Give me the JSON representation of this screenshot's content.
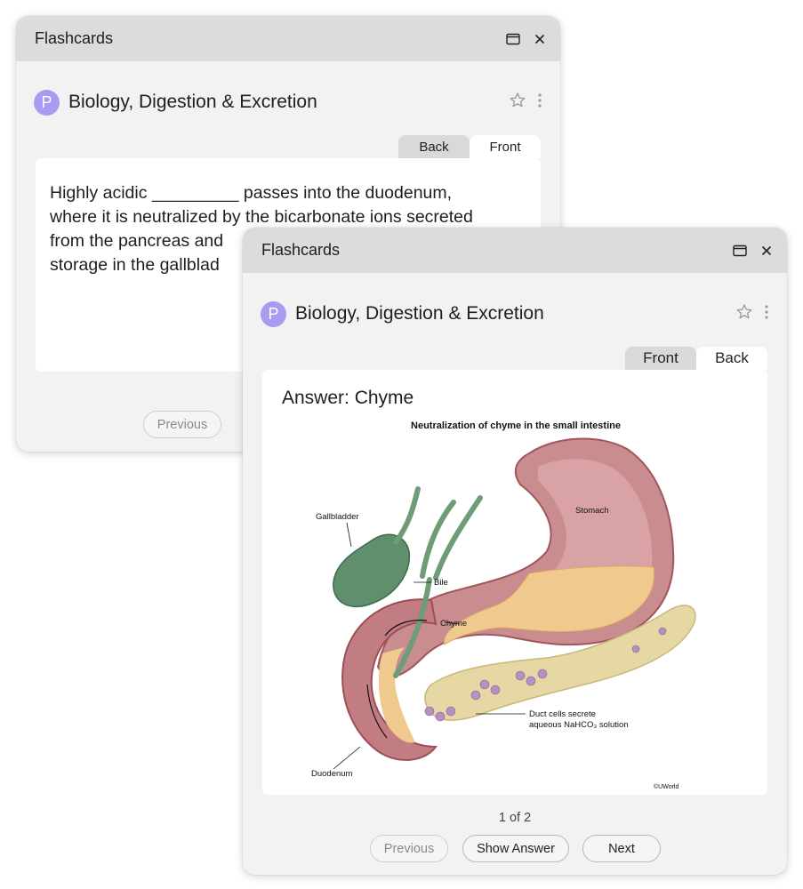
{
  "back_window": {
    "title": "Flashcards",
    "deck": {
      "avatar_letter": "P",
      "name": "Biology, Digestion & Excretion"
    },
    "tabs": [
      {
        "label": "Back",
        "active": false
      },
      {
        "label": "Front",
        "active": true
      }
    ],
    "card_text": "Highly acidic _________ passes into the duodenum, where it is neutralized by the bicarbonate ions secreted from the pancreas and ... storage in the gallblad...",
    "card_lines": [
      "Highly acidic _________ passes into the duodenum,",
      "where it is neutralized by the bicarbonate ions secreted",
      "from the pancreas and",
      "storage in the gallblad"
    ],
    "buttons": {
      "previous": "Previous"
    }
  },
  "front_window": {
    "title": "Flashcards",
    "deck": {
      "avatar_letter": "P",
      "name": "Biology, Digestion & Excretion"
    },
    "tabs": [
      {
        "label": "Front",
        "active": false
      },
      {
        "label": "Back",
        "active": true
      }
    ],
    "answer": "Answer: Chyme",
    "diagram": {
      "title": "Neutralization of chyme in the small intestine",
      "labels": {
        "gallbladder": "Gallbladder",
        "stomach": "Stomach",
        "bile": "Bile",
        "chyme": "Chyme",
        "duct_line1": "Duct cells secrete",
        "duct_line2": "aqueous NaHCO₃ solution",
        "duodenum": "Duodenum",
        "credit": "©UWorld"
      }
    },
    "pagination": "1 of 2",
    "buttons": {
      "previous": "Previous",
      "show_answer": "Show Answer",
      "next": "Next"
    }
  },
  "icons": {
    "window": "window-icon",
    "close": "close-icon",
    "star": "star-icon",
    "menu": "kebab-menu-icon"
  },
  "colors": {
    "avatar": "#a99bf0",
    "titlebar": "#dcdcdc",
    "panel": "#f2f2f2",
    "card": "#ffffff"
  }
}
